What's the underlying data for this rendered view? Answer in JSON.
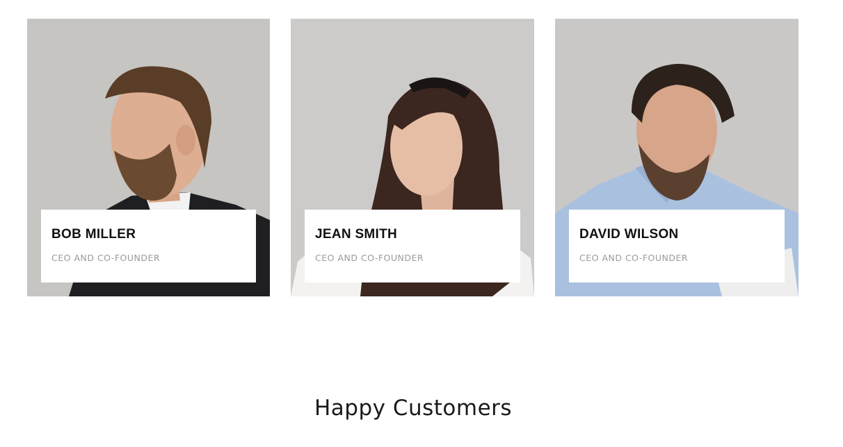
{
  "team": {
    "members": [
      {
        "name": "BOB MILLER",
        "role": "CEO AND CO-FOUNDER"
      },
      {
        "name": "JEAN SMITH",
        "role": "CEO AND CO-FOUNDER"
      },
      {
        "name": "DAVID WILSON",
        "role": "CEO AND CO-FOUNDER"
      }
    ]
  },
  "testimonials": {
    "title": "Happy Customers"
  },
  "colors": {
    "photo_background": "#c9c7c5",
    "name_text": "#111111",
    "role_text": "#9a9a9a",
    "card_box": "#ffffff"
  }
}
